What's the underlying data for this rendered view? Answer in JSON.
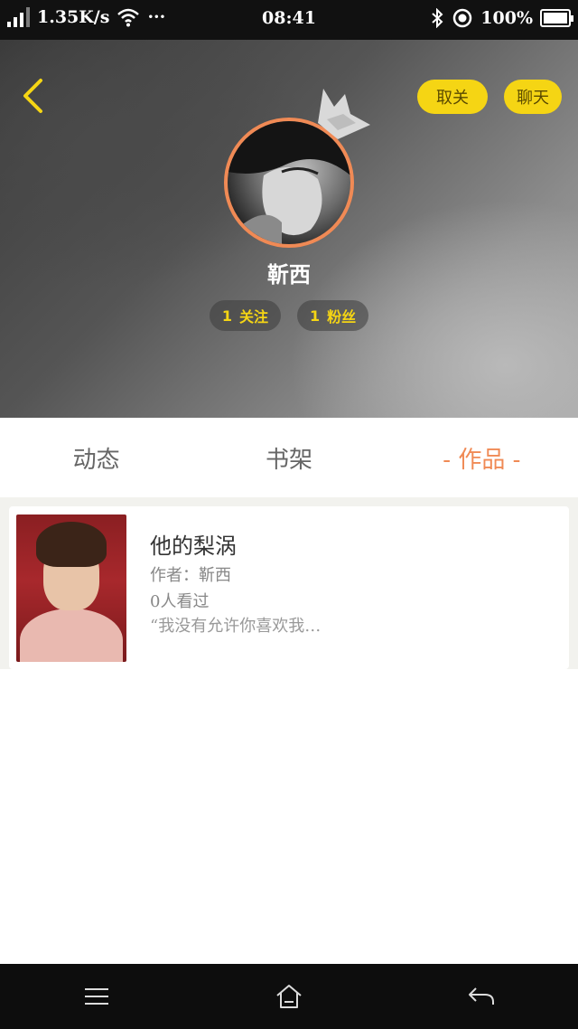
{
  "status_bar": {
    "speed": "1.35K/s",
    "dots": "···",
    "time": "08:41",
    "battery": "100%",
    "icons": [
      "signal-icon",
      "wifi-icon",
      "bluetooth-icon",
      "location-icon",
      "battery-icon"
    ]
  },
  "header": {
    "back_icon": "back-chevron-icon",
    "unfollow_label": "取关",
    "chat_label": "聊天",
    "username": "靳西",
    "following_count": "1",
    "following_label": "关注",
    "fans_count": "1",
    "fans_label": "粉丝"
  },
  "tabs": [
    {
      "label": "动态",
      "active": false
    },
    {
      "label": "书架",
      "active": false
    },
    {
      "label": "- 作品 -",
      "active": true
    }
  ],
  "works": [
    {
      "title": "他的梨涡",
      "author": "作者：靳西",
      "views": "0人看过",
      "excerpt": "“我没有允许你喜欢我…"
    }
  ],
  "nav_bar": {
    "icons": [
      "menu-icon",
      "home-icon",
      "back-icon"
    ]
  },
  "colors": {
    "accent_yellow": "#f5d514",
    "accent_orange": "#f08a55"
  }
}
